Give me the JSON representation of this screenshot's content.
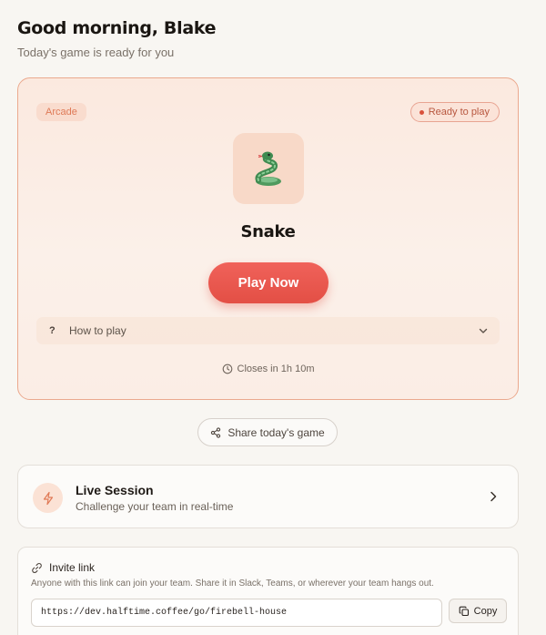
{
  "header": {
    "greeting": "Good morning, Blake",
    "subtitle": "Today's game is ready for you"
  },
  "game": {
    "category": "Arcade",
    "status": "Ready to play",
    "icon": "snake-emoji",
    "emoji": "🐍",
    "title": "Snake",
    "play_label": "Play Now",
    "howto_label": "How to play",
    "closes_label": "Closes in 1h 10m"
  },
  "share": {
    "label": "Share today's game"
  },
  "live_session": {
    "title": "Live Session",
    "subtitle": "Challenge your team in real-time"
  },
  "invite": {
    "title": "Invite link",
    "description": "Anyone with this link can join your team. Share it in Slack, Teams, or wherever your team hangs out.",
    "url": "https://dev.halftime.coffee/go/firebell-house",
    "copy_label": "Copy"
  },
  "colors": {
    "accent": "#e8564c",
    "card_border": "#eba98e",
    "background": "#f8f6f2"
  }
}
